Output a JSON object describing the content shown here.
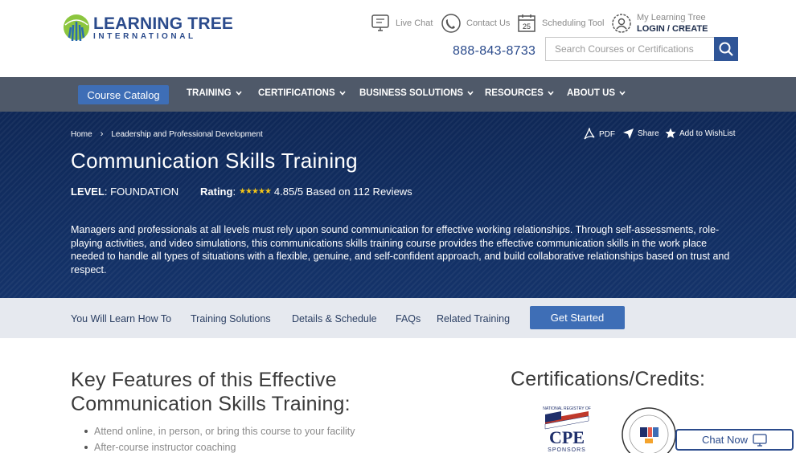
{
  "header": {
    "logo": {
      "line1": "LEARNING TREE",
      "line2": "INTERNATIONAL"
    },
    "live_chat": "Live Chat",
    "contact_us": "Contact Us",
    "scheduling_tool": "Scheduling Tool",
    "calendar_day": "25",
    "account_label": "My Learning Tree",
    "account_action": "LOGIN / CREATE",
    "phone": "888-843-8733",
    "search": {
      "placeholder": "Search Courses or Certifications",
      "value": ""
    }
  },
  "nav": {
    "catalog": "Course Catalog",
    "items": [
      "TRAINING",
      "CERTIFICATIONS",
      "BUSINESS SOLUTIONS",
      "RESOURCES",
      "ABOUT US"
    ]
  },
  "hero": {
    "breadcrumbs": [
      "Home",
      "Leadership and Professional Development"
    ],
    "tools": {
      "pdf": "PDF",
      "share": "Share",
      "wishlist": "Add to WishList"
    },
    "title": "Communication Skills Training",
    "level_label": "LEVEL",
    "level_value": ": FOUNDATION",
    "rating_label": "Rating",
    "rating_colon": ":",
    "rating_text": "4.85/5 Based on 112 Reviews",
    "rating_value": 4.85,
    "description": "Managers and professionals at all levels must rely upon sound communication for effective working relationships. Through self-assessments, role-playing activities, and video simulations, this communications skills training course provides the effective communication skills in the work place needed to handle all types of situations with a flexible, genuine, and self-confident approach, and build collaborative relationships based on trust and respect."
  },
  "tabs": {
    "items": [
      "You Will Learn How To",
      "Training Solutions",
      "Details & Schedule",
      "FAQs",
      "Related Training"
    ],
    "cta": "Get Started"
  },
  "features": {
    "title": "Key Features of this Effective Communication Skills Training:",
    "items": [
      "Attend online, in person, or bring this course to your facility",
      "After-course instructor coaching"
    ]
  },
  "certifications": {
    "title": "Certifications/Credits:",
    "cpe_text": "CPE",
    "cpe_sub": "SPONSORS",
    "cpe_arc": "NATIONAL REGISTRY OF"
  },
  "chat": {
    "label": "Chat Now"
  },
  "colors": {
    "brand_blue": "#2b4b8c",
    "nav_bg": "#4f5969",
    "button_blue": "#3e6eb6",
    "hero_bg": "#0f2a55",
    "star": "#f4c518"
  }
}
